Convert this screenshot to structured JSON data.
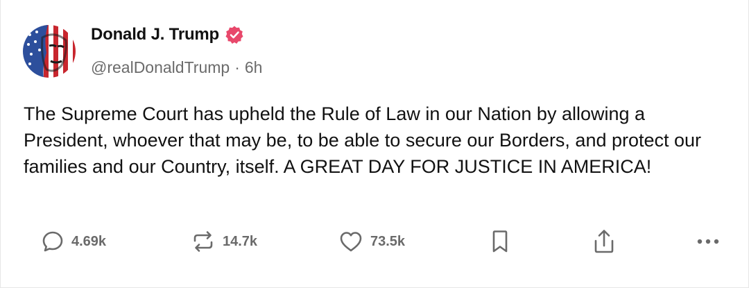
{
  "author": {
    "display_name": "Donald J. Trump",
    "handle": "@realDonaldTrump",
    "separator": "·",
    "time_ago": "6h",
    "verified_color": "#e8486b"
  },
  "post": {
    "text": "The Supreme Court has upheld the Rule of Law in our Nation by allowing a President, whoever that may be, to be able to secure our Borders, and protect our families and our Country, itself. A GREAT DAY FOR JUSTICE IN AMERICA!"
  },
  "actions": {
    "replies": {
      "icon": "reply-icon",
      "count": "4.69k"
    },
    "reposts": {
      "icon": "repost-icon",
      "count": "14.7k"
    },
    "likes": {
      "icon": "heart-icon",
      "count": "73.5k"
    },
    "bookmark": {
      "icon": "bookmark-icon"
    },
    "share": {
      "icon": "share-icon"
    },
    "more": {
      "icon": "more-icon"
    }
  }
}
